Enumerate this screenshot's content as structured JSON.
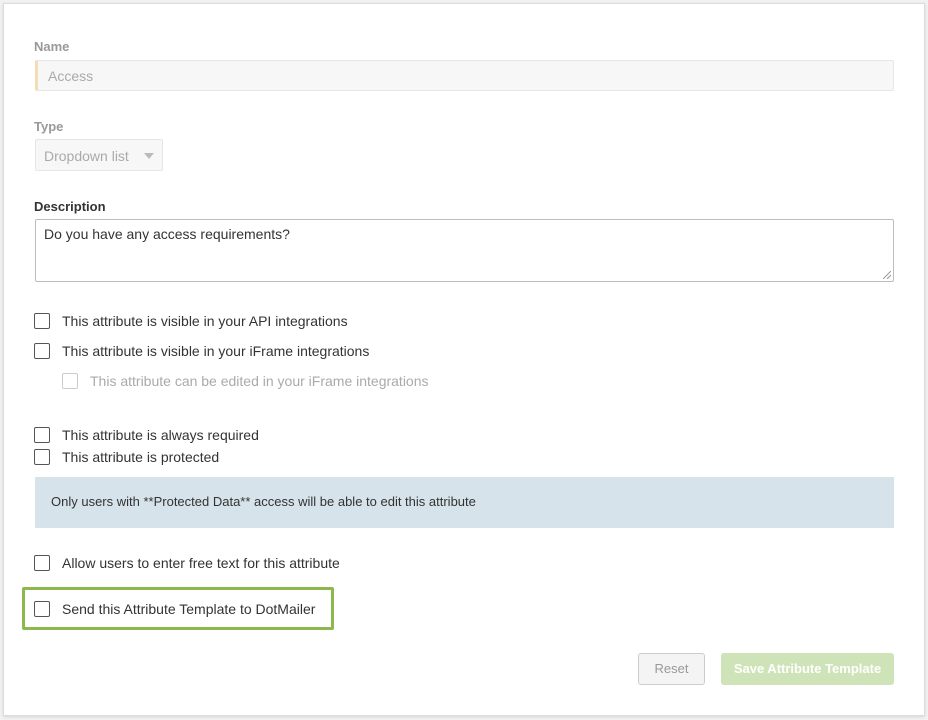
{
  "form": {
    "name_label": "Name",
    "name_value": "Access",
    "type_label": "Type",
    "type_value": "Dropdown list",
    "description_label": "Description",
    "description_value": "Do you have any access requirements?"
  },
  "checkboxes": {
    "api_visible": "This attribute is visible in your API integrations",
    "iframe_visible": "This attribute is visible in your iFrame integrations",
    "iframe_editable": "This attribute can be edited in your iFrame integrations",
    "always_required": "This attribute is always required",
    "protected": "This attribute is protected",
    "free_text": "Allow users to enter free text for this attribute",
    "dotmailer": "Send this Attribute Template to DotMailer"
  },
  "info": {
    "protected_note": "Only users with **Protected Data** access will be able to edit this attribute"
  },
  "buttons": {
    "reset": "Reset",
    "save": "Save Attribute Template"
  },
  "colors": {
    "highlight": "#8cb84e",
    "info_bg": "#d6e3ea",
    "save_bg": "#cfe3b8"
  }
}
